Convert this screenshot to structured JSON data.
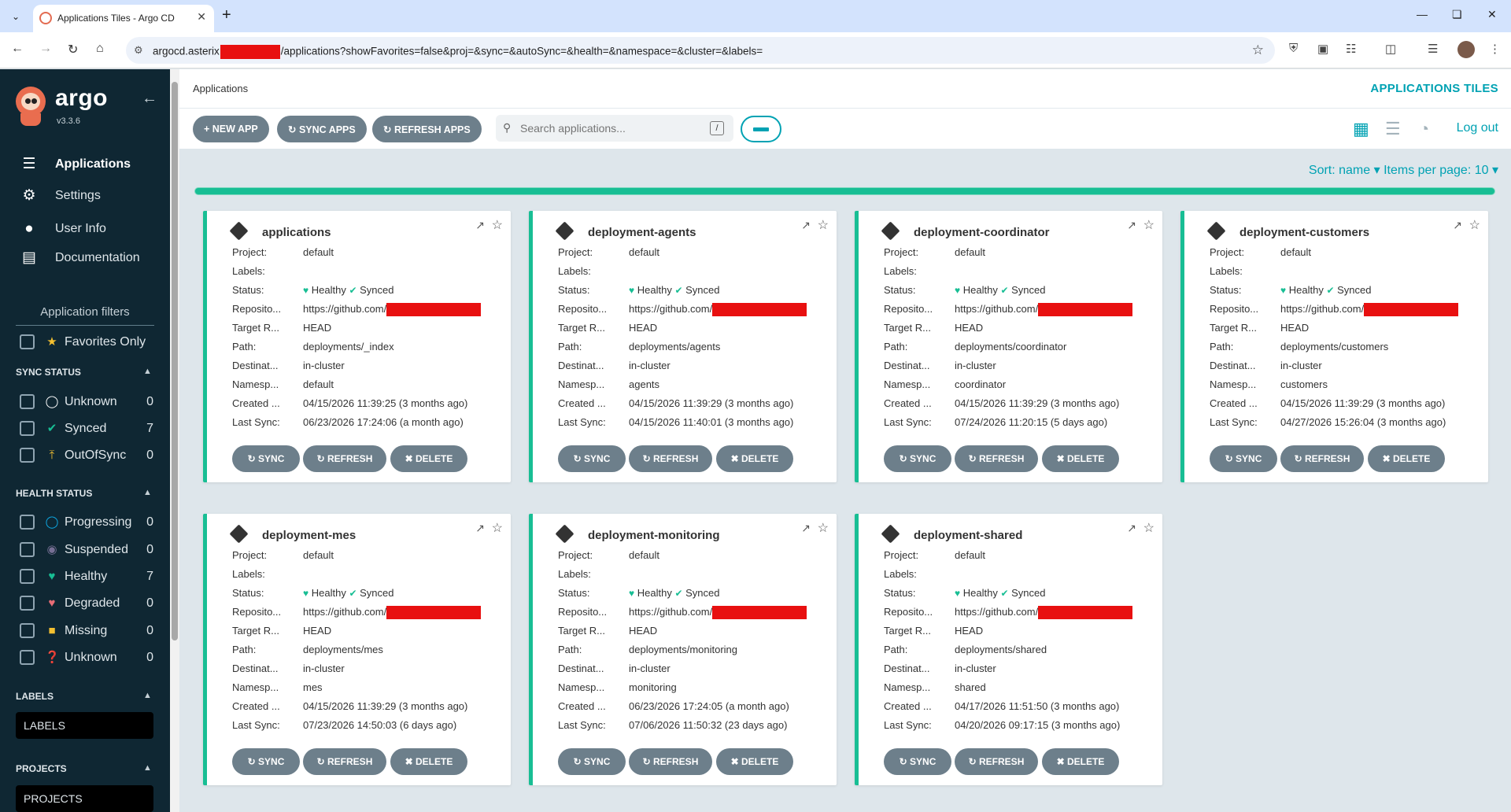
{
  "browser": {
    "tab_title": "Applications Tiles - Argo CD",
    "url_prefix": "argocd.asterix",
    "url_suffix": "/applications?showFavorites=false&proj=&sync=&autoSync=&health=&namespace=&cluster=&labels="
  },
  "sidebar": {
    "brand": "argo",
    "version": "v3.3.6",
    "nav": [
      {
        "label": "Applications",
        "icon": "layers-icon",
        "active": true
      },
      {
        "label": "Settings",
        "icon": "gear-icon"
      },
      {
        "label": "User Info",
        "icon": "user-icon"
      },
      {
        "label": "Documentation",
        "icon": "book-icon"
      }
    ],
    "filters_title": "Application filters",
    "favorites_label": "Favorites Only",
    "sync_status_title": "SYNC STATUS",
    "sync_status": [
      {
        "label": "Unknown",
        "count": "0",
        "icon": "circle-notch-icon",
        "color": "#ffffff"
      },
      {
        "label": "Synced",
        "count": "7",
        "icon": "check-circle-icon",
        "color": "#18be94"
      },
      {
        "label": "OutOfSync",
        "count": "0",
        "icon": "arrow-up-circle-icon",
        "color": "#f4c030"
      }
    ],
    "health_status_title": "HEALTH STATUS",
    "health_status": [
      {
        "label": "Progressing",
        "count": "0",
        "icon": "circle-notch-icon",
        "color": "#0dadea"
      },
      {
        "label": "Suspended",
        "count": "0",
        "icon": "pause-circle-icon",
        "color": "#766f94"
      },
      {
        "label": "Healthy",
        "count": "7",
        "icon": "heart-icon",
        "color": "#18be94"
      },
      {
        "label": "Degraded",
        "count": "0",
        "icon": "heart-broken-icon",
        "color": "#e96d76"
      },
      {
        "label": "Missing",
        "count": "0",
        "icon": "ghost-icon",
        "color": "#f4c030"
      },
      {
        "label": "Unknown",
        "count": "0",
        "icon": "question-circle-icon",
        "color": "#ccd6dd"
      }
    ],
    "labels_title": "LABELS",
    "labels_placeholder": "LABELS",
    "projects_title": "PROJECTS",
    "projects_placeholder": "PROJECTS"
  },
  "main": {
    "breadcrumb": "Applications",
    "page_title": "APPLICATIONS TILES",
    "new_app": "NEW APP",
    "sync_apps": "SYNC APPS",
    "refresh_apps": "REFRESH APPS",
    "search_placeholder": "Search applications...",
    "search_shortcut": "/",
    "logout": "Log out",
    "sort_label": "Sort: name",
    "items_per_page": "Items per page: 10"
  },
  "card_labels": {
    "project": "Project:",
    "labels": "Labels:",
    "status": "Status:",
    "repo": "Reposito...",
    "target": "Target R...",
    "path": "Path:",
    "dest": "Destinat...",
    "ns": "Namesp...",
    "created": "Created ...",
    "last_sync": "Last Sync:",
    "healthy": "Healthy",
    "synced": "Synced",
    "repo_prefix": "https://github.com/",
    "sync_btn": "SYNC",
    "refresh_btn": "REFRESH",
    "delete_btn": "DELETE"
  },
  "apps": [
    {
      "name": "applications",
      "project": "default",
      "target": "HEAD",
      "path": "deployments/_index",
      "dest": "in-cluster",
      "ns": "default",
      "created": "04/15/2026 11:39:25  (3 months ago)",
      "last_sync": "06/23/2026 17:24:06  (a month ago)"
    },
    {
      "name": "deployment-agents",
      "project": "default",
      "target": "HEAD",
      "path": "deployments/agents",
      "dest": "in-cluster",
      "ns": "agents",
      "created": "04/15/2026 11:39:29  (3 months ago)",
      "last_sync": "04/15/2026 11:40:01  (3 months ago)"
    },
    {
      "name": "deployment-coordinator",
      "project": "default",
      "target": "HEAD",
      "path": "deployments/coordinator",
      "dest": "in-cluster",
      "ns": "coordinator",
      "created": "04/15/2026 11:39:29  (3 months ago)",
      "last_sync": "07/24/2026 11:20:15  (5 days ago)"
    },
    {
      "name": "deployment-customers",
      "project": "default",
      "target": "HEAD",
      "path": "deployments/customers",
      "dest": "in-cluster",
      "ns": "customers",
      "created": "04/15/2026 11:39:29  (3 months ago)",
      "last_sync": "04/27/2026 15:26:04  (3 months ago)"
    },
    {
      "name": "deployment-mes",
      "project": "default",
      "target": "HEAD",
      "path": "deployments/mes",
      "dest": "in-cluster",
      "ns": "mes",
      "created": "04/15/2026 11:39:29  (3 months ago)",
      "last_sync": "07/23/2026 14:50:03  (6 days ago)"
    },
    {
      "name": "deployment-monitoring",
      "project": "default",
      "target": "HEAD",
      "path": "deployments/monitoring",
      "dest": "in-cluster",
      "ns": "monitoring",
      "created": "06/23/2026 17:24:05  (a month ago)",
      "last_sync": "07/06/2026 11:50:32  (23 days ago)"
    },
    {
      "name": "deployment-shared",
      "project": "default",
      "target": "HEAD",
      "path": "deployments/shared",
      "dest": "in-cluster",
      "ns": "shared",
      "created": "04/17/2026 11:51:50  (3 months ago)",
      "last_sync": "04/20/2026 09:17:15  (3 months ago)"
    }
  ]
}
